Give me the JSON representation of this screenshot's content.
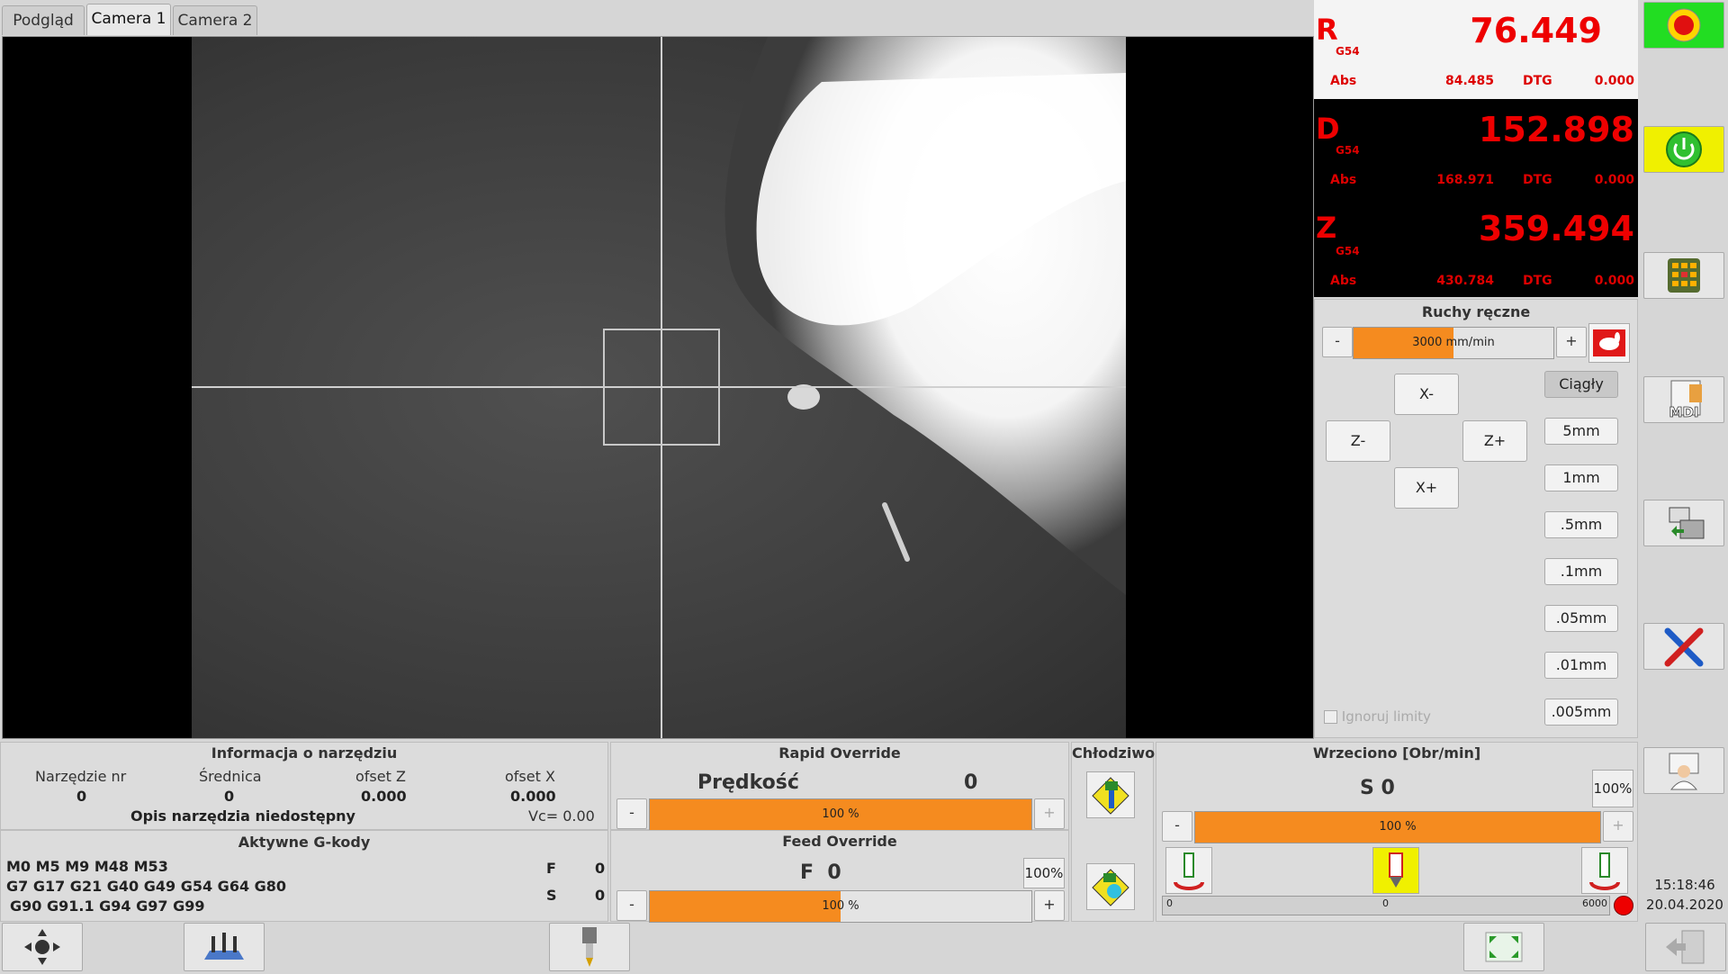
{
  "tabs": [
    "Podgląd",
    "Camera 1",
    "Camera 2"
  ],
  "dro": {
    "r": {
      "letter": "R",
      "cs": "G54",
      "value": "76.449",
      "abs_label": "Abs",
      "abs": "84.485",
      "dtg_label": "DTG",
      "dtg": "0.000"
    },
    "d": {
      "letter": "D",
      "cs": "G54",
      "value": "152.898",
      "abs_label": "Abs",
      "abs": "168.971",
      "dtg_label": "DTG",
      "dtg": "0.000"
    },
    "z": {
      "letter": "Z",
      "cs": "G54",
      "value": "359.494",
      "abs_label": "Abs",
      "abs": "430.784",
      "dtg_label": "DTG",
      "dtg": "0.000"
    }
  },
  "jog": {
    "title": "Ruchy ręczne",
    "feed_label": "3000 mm/min",
    "feed_fraction": 0.5,
    "minus": "-",
    "plus": "+",
    "x_minus": "X-",
    "x_plus": "X+",
    "z_minus": "Z-",
    "z_plus": "Z+",
    "steps": [
      "Ciągły",
      "5mm",
      "1mm",
      ".5mm",
      ".1mm",
      ".05mm",
      ".01mm",
      ".005mm"
    ],
    "ignore_limits": "Ignoruj limity"
  },
  "tool": {
    "title": "Informacja o narzędziu",
    "headers": [
      "Narzędzie nr",
      "Średnica",
      "ofset Z",
      "ofset X"
    ],
    "values": [
      "0",
      "0",
      "0.000",
      "0.000"
    ],
    "desc": "Opis narzędzia niedostępny",
    "vc": "Vc= 0.00"
  },
  "gcodes": {
    "title": "Aktywne G-kody",
    "lines": [
      "M0 M5 M9 M48 M53",
      "G7 G17 G21 G40 G49 G54 G64 G80",
      "G90 G91.1 G94 G97 G99"
    ],
    "f_label": "F",
    "f_value": "0",
    "s_label": "S",
    "s_value": "0"
  },
  "rapid": {
    "title": "Rapid Override",
    "speed_label": "Prędkość",
    "speed_value": "0",
    "bar_text": "100 %",
    "fraction": 1.0
  },
  "feed": {
    "title": "Feed Override",
    "f_text": "F  0",
    "pct_button": "100%",
    "bar_text": "100 %",
    "fraction": 0.5
  },
  "coolant": {
    "title": "Chłodziwo"
  },
  "spindle": {
    "title": "Wrzeciono [Obr/min]",
    "s_text": "S 0",
    "pct_button": "100%",
    "bar_text": "100 %",
    "fraction": 1.0,
    "scale_min": "0",
    "scale_mid": "0",
    "scale_max": "6000"
  },
  "clock": {
    "time": "15:18:46",
    "date": "20.04.2020"
  },
  "colors": {
    "orange": "#f58b1f",
    "dro_red": "#e00000",
    "estop_green": "#22dd22",
    "power_yellow": "#f0f000"
  }
}
